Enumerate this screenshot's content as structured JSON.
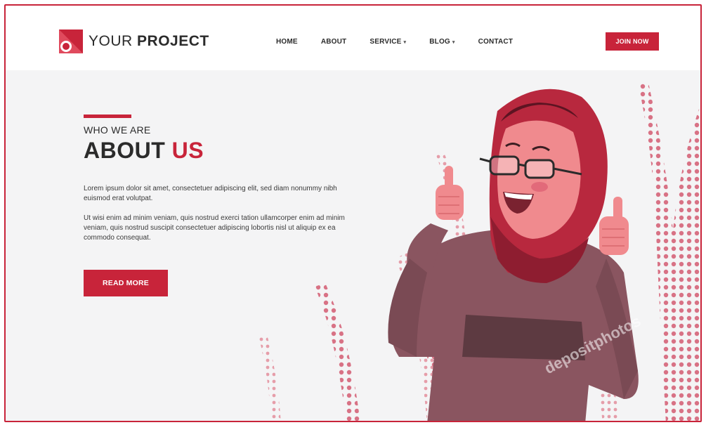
{
  "brand": {
    "name_light": "YOUR",
    "name_bold": "PROJECT",
    "logo_icon": "logo-mark-icon",
    "accent_color": "#c8243a"
  },
  "nav": {
    "home": "HOME",
    "about": "ABOUT",
    "service": "SERVICE",
    "blog": "BLOG",
    "contact": "CONTACT"
  },
  "header": {
    "join_label": "JOIN NOW"
  },
  "hero": {
    "eyebrow": "WHO WE ARE",
    "title_dark": "ABOUT",
    "title_red": "US",
    "paragraph_1": "Lorem ipsum dolor sit amet, consectetuer adipiscing elit, sed diam nonummy nibh euismod erat volutpat.",
    "paragraph_2": "Ut wisi enim ad minim veniam, quis nostrud exerci tation ullamcorper enim ad minim veniam, quis nostrud suscipit consectetuer adipiscing  lobortis nisl ut aliquip ex ea commodo consequat.",
    "cta_label": "READ MORE"
  },
  "illustration": {
    "subject": "woman-in-hijab-thumbs-up-illustration",
    "watermark": "depositphotos"
  }
}
